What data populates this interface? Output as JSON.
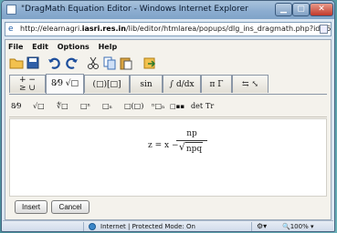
{
  "window": {
    "title": "\"DragMath Equation Editor - Windows Internet Explorer",
    "address_prefix": "http://elearnagri.",
    "address_domain": "iasri.res.in",
    "address_suffix": "/lib/editor/htmlarea/popups/dlg_ins_dragmath.php?id=6"
  },
  "menu": {
    "file": "File",
    "edit": "Edit",
    "options": "Options",
    "help": "Help"
  },
  "toolbar": {
    "icons": [
      "open-folder-icon",
      "save-icon",
      "undo-icon",
      "redo-icon",
      "cut-icon",
      "copy-icon",
      "paste-icon",
      "export-icon"
    ]
  },
  "tabs": [
    {
      "label": "+ −\n≥ ∪"
    },
    {
      "label": "8⁄9 √□"
    },
    {
      "label": "(□)[□]"
    },
    {
      "label": "sin"
    },
    {
      "label": "∫ d/dx"
    },
    {
      "label": "π Γ"
    },
    {
      "label": "⇆ ⤡"
    }
  ],
  "palette": {
    "frac": "8⁄9",
    "sqrt": "√□",
    "nroot": "∜□",
    "power": "□ⁿ",
    "subscript": "□ₙ",
    "paren_fn": "□(□)",
    "subsup": "ⁿ□ₙ",
    "matrix": "□▪▪",
    "det": "det",
    "tr": "Tr"
  },
  "equation": {
    "lhs": "z = x −",
    "numerator": "np",
    "denominator": "npq"
  },
  "buttons": {
    "insert": "Insert",
    "cancel": "Cancel"
  },
  "status": {
    "zone_text": "Internet | Protected Mode: On",
    "zoom": "100%"
  }
}
